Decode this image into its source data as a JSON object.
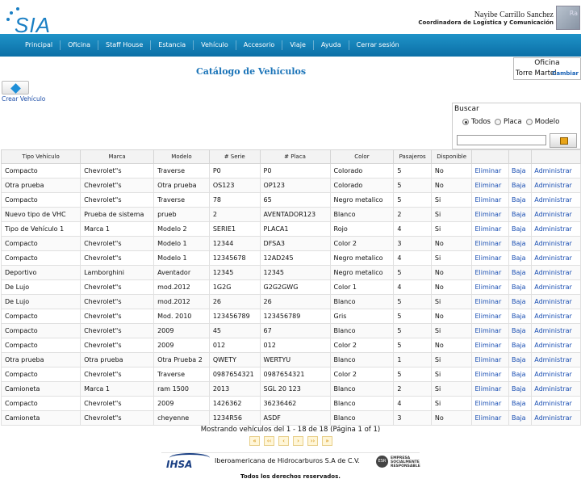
{
  "app": {
    "logo": "SIA"
  },
  "user": {
    "name": "Nayibe Carrillo Sanchez",
    "role": "Coordinadora de Logística y Comunicación"
  },
  "nav": [
    "Principal",
    "Oficina",
    "Staff House",
    "Estancia",
    "Vehículo",
    "Accesorio",
    "Viaje",
    "Ayuda",
    "Cerrar sesión"
  ],
  "office": {
    "title": "Oficina",
    "name": "Torre Martel",
    "change": "Cambiar"
  },
  "page": {
    "title": "Catálogo de Vehículos",
    "create_label": "Crear Vehículo"
  },
  "search": {
    "label": "Buscar",
    "options": [
      "Todos",
      "Placa",
      "Modelo"
    ],
    "selected": "Todos",
    "value": ""
  },
  "table": {
    "headers": [
      "Tipo Vehículo",
      "Marca",
      "Modelo",
      "# Serie",
      "# Placa",
      "Color",
      "Pasajeros",
      "Disponible",
      "",
      "",
      ""
    ],
    "actions": [
      "Eliminar",
      "Baja",
      "Administrar"
    ],
    "rows": [
      [
        "Compacto",
        "Chevrolet\"s",
        "Traverse",
        "P0",
        "P0",
        "Colorado",
        "5",
        "No"
      ],
      [
        "Otra prueba",
        "Chevrolet\"s",
        "Otra prueba",
        "OS123",
        "OP123",
        "Colorado",
        "5",
        "No"
      ],
      [
        "Compacto",
        "Chevrolet\"s",
        "Traverse",
        "78",
        "65",
        "Negro metalico",
        "5",
        "Si"
      ],
      [
        "Nuevo tipo de VHC",
        "Prueba de sistema",
        "prueb",
        "2",
        "AVENTADOR123",
        "Blanco",
        "2",
        "Si"
      ],
      [
        "Tipo de Vehículo 1",
        "Marca 1",
        "Modelo 2",
        "SERIE1",
        "PLACA1",
        "Rojo",
        "4",
        "Si"
      ],
      [
        "Compacto",
        "Chevrolet\"s",
        "Modelo 1",
        "12344",
        "DFSA3",
        "Color 2",
        "3",
        "No"
      ],
      [
        "Compacto",
        "Chevrolet\"s",
        "Modelo 1",
        "12345678",
        "12AD245",
        "Negro metalico",
        "4",
        "Si"
      ],
      [
        "Deportivo",
        "Lamborghini",
        "Aventador",
        "12345",
        "12345",
        "Negro metalico",
        "5",
        "No"
      ],
      [
        "De Lujo",
        "Chevrolet\"s",
        "mod.2012",
        "1G2G",
        "G2G2GWG",
        "Color 1",
        "4",
        "No"
      ],
      [
        "De Lujo",
        "Chevrolet\"s",
        "mod.2012",
        "26",
        "26",
        "Blanco",
        "5",
        "Si"
      ],
      [
        "Compacto",
        "Chevrolet\"s",
        "Mod. 2010",
        "123456789",
        "123456789",
        "Gris",
        "5",
        "No"
      ],
      [
        "Compacto",
        "Chevrolet\"s",
        "2009",
        "45",
        "67",
        "Blanco",
        "5",
        "Si"
      ],
      [
        "Compacto",
        "Chevrolet\"s",
        "2009",
        "012",
        "012",
        "Color 2",
        "5",
        "No"
      ],
      [
        "Otra prueba",
        "Otra prueba",
        "Otra Prueba 2",
        "QWETY",
        "WERTYU",
        "Blanco",
        "1",
        "Si"
      ],
      [
        "Compacto",
        "Chevrolet\"s",
        "Traverse",
        "0987654321",
        "0987654321",
        "Color 2",
        "5",
        "Si"
      ],
      [
        "Camioneta",
        "Marca 1",
        "ram 1500",
        "2013",
        "SGL 20 123",
        "Blanco",
        "2",
        "Si"
      ],
      [
        "Compacto",
        "Chevrolet\"s",
        "2009",
        "1426362",
        "36236462",
        "Blanco",
        "4",
        "Si"
      ],
      [
        "Camioneta",
        "Chevrolet\"s",
        "cheyenne",
        "1234R56",
        "ASDF",
        "Blanco",
        "3",
        "No"
      ]
    ]
  },
  "pager": {
    "text": "Mostrando vehículos del 1 - 18 de 18 (Página 1 of 1)"
  },
  "footer": {
    "logo": "IHSA",
    "company": "Iberoamericana de Hidrocarburos S.A de C.V.",
    "esr": "ESR",
    "esr_text": "EMPRESA SOCIALMENTE RESPONSABLE",
    "rights": "Todos los derechos reservados."
  }
}
